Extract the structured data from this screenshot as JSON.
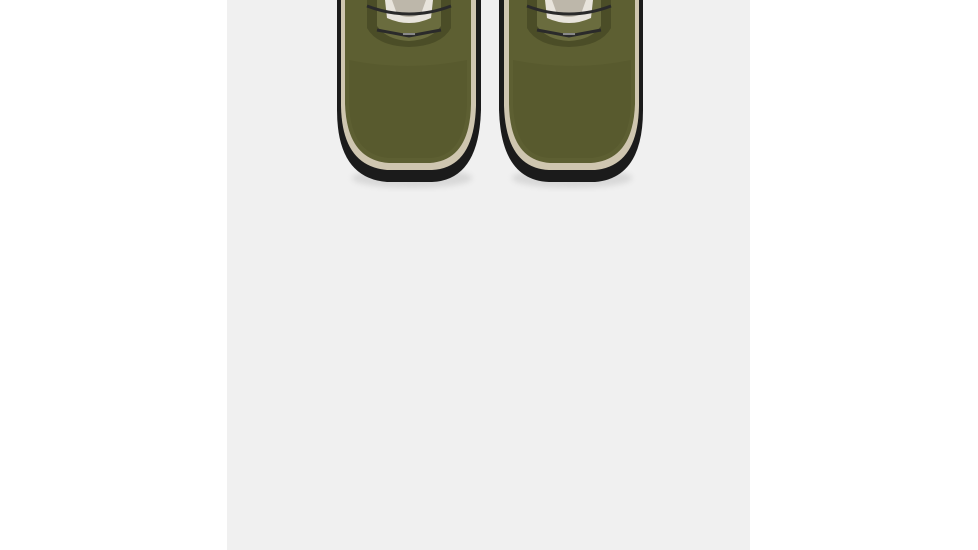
{
  "product_image": {
    "subject": "pair-of-olive-suede-winter-boots",
    "view": "top-down",
    "colors": {
      "background": "#f0f0f0",
      "suede": "#5d5f32",
      "suede_shadow": "#4b4d27",
      "midsole": "#cfc6b0",
      "outsole": "#1b1b1b",
      "tongue": "#6a6c3e",
      "fur": "#e8e4dc",
      "laces": "#2a2a2a"
    }
  }
}
